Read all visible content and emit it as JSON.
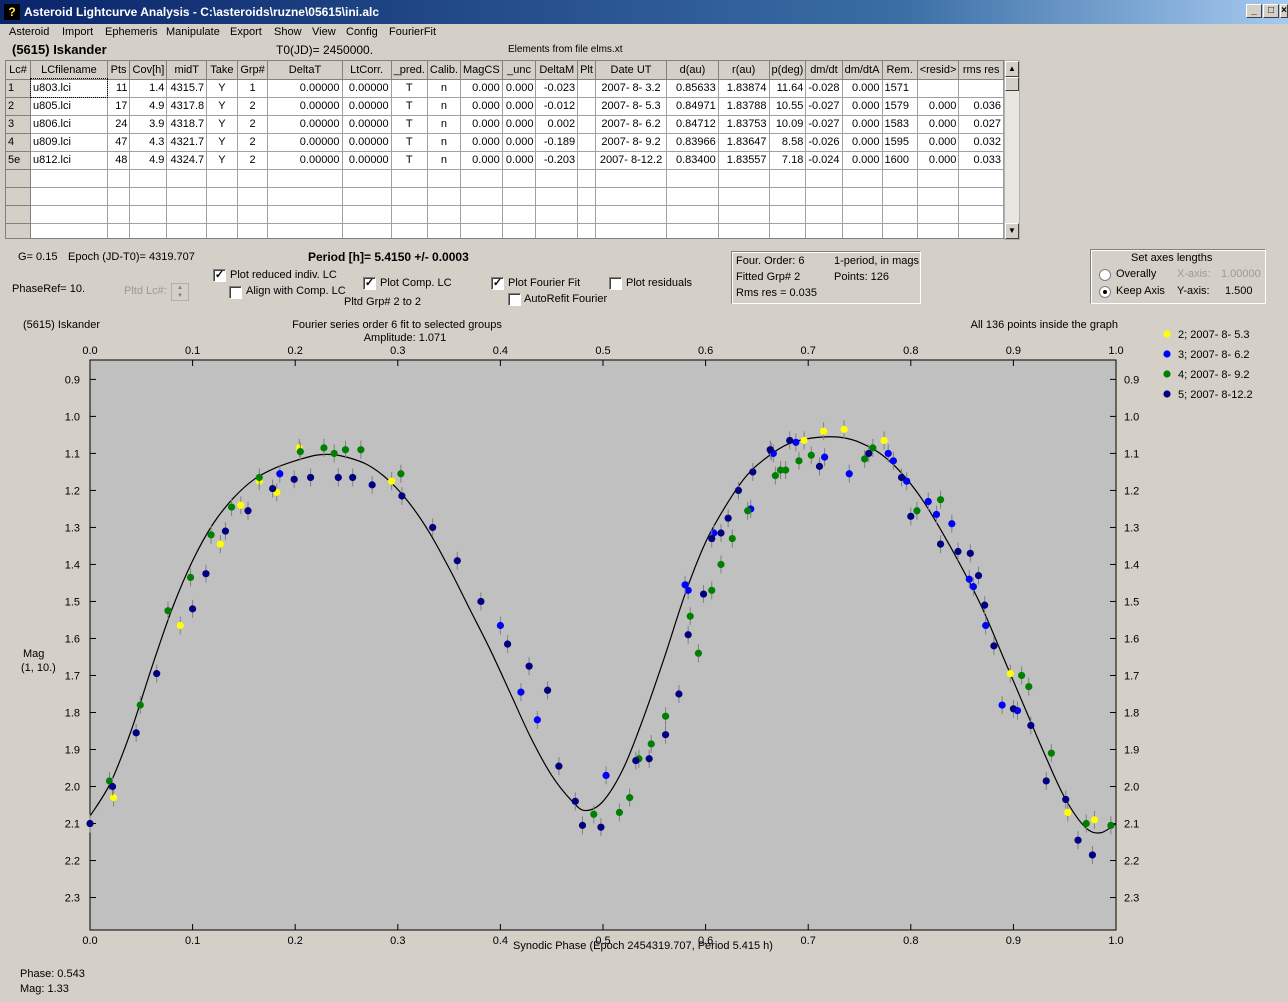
{
  "window": {
    "title": "Asteroid Lightcurve Analysis - C:\\asteroids\\ruzne\\05615\\ini.alc",
    "min": "_",
    "max": "□",
    "close": "×"
  },
  "menu": [
    "Asteroid",
    "Import",
    "Ephemeris",
    "Manipulate",
    "Export",
    "Show",
    "View",
    "Config",
    "FourierFit"
  ],
  "header": {
    "asteroid": "(5615) Iskander",
    "t0": "T0(JD)= 2450000.",
    "elements": "Elements from file elms.xt"
  },
  "table": {
    "columns": [
      "Lc#",
      "LCfilename",
      "Pts",
      "Cov[h]",
      "midT",
      "Take",
      "Grp#",
      "DeltaT",
      "LtCorr.",
      "_pred.",
      "Calib.",
      "MagCS",
      "_unc",
      "DeltaM",
      "Plt",
      "Date UT",
      "d(au)",
      "r(au)",
      "p(deg)",
      "dm/dt",
      "dm/dtA",
      "Rem.",
      "<resid>",
      "rms res"
    ],
    "rows": [
      [
        "1",
        "u803.lci",
        "11",
        "1.4",
        "4315.7",
        "Y",
        "1",
        "0.00000",
        "0.00000",
        "T",
        "n",
        "0.000",
        "0.000",
        "-0.023",
        "",
        "2007- 8- 3.2",
        "0.85633",
        "1.83874",
        "11.64",
        "-0.028",
        "0.000",
        "1571",
        "",
        ""
      ],
      [
        "2",
        "u805.lci",
        "17",
        "4.9",
        "4317.8",
        "Y",
        "2",
        "0.00000",
        "0.00000",
        "T",
        "n",
        "0.000",
        "0.000",
        "-0.012",
        "",
        "2007- 8- 5.3",
        "0.84971",
        "1.83788",
        "10.55",
        "-0.027",
        "0.000",
        "1579",
        "0.000",
        "0.036"
      ],
      [
        "3",
        "u806.lci",
        "24",
        "3.9",
        "4318.7",
        "Y",
        "2",
        "0.00000",
        "0.00000",
        "T",
        "n",
        "0.000",
        "0.000",
        "0.002",
        "",
        "2007- 8- 6.2",
        "0.84712",
        "1.83753",
        "10.09",
        "-0.027",
        "0.000",
        "1583",
        "0.000",
        "0.027"
      ],
      [
        "4",
        "u809.lci",
        "47",
        "4.3",
        "4321.7",
        "Y",
        "2",
        "0.00000",
        "0.00000",
        "T",
        "n",
        "0.000",
        "0.000",
        "-0.189",
        "",
        "2007- 8- 9.2",
        "0.83966",
        "1.83647",
        "8.58",
        "-0.026",
        "0.000",
        "1595",
        "0.000",
        "0.032"
      ],
      [
        "5e",
        "u812.lci",
        "48",
        "4.9",
        "4324.7",
        "Y",
        "2",
        "0.00000",
        "0.00000",
        "T",
        "n",
        "0.000",
        "0.000",
        "-0.203",
        "",
        "2007- 8-12.2",
        "0.83400",
        "1.83557",
        "7.18",
        "-0.024",
        "0.000",
        "1600",
        "0.000",
        "0.033"
      ]
    ],
    "empty_rows": 4
  },
  "info": {
    "g": "G= 0.15",
    "epoch": "Epoch (JD-T0)= 4319.707",
    "period": "Period [h]= 5.4150 +/- 0.0003",
    "phaseref": "PhaseRef= 10.",
    "pltd_lc": "Pltd Lc#:",
    "pltd_grp": "Pltd Grp#  2   to   2"
  },
  "checkboxes": {
    "plot_reduced": {
      "label": "Plot reduced indiv. LC",
      "checked": true
    },
    "align_comp": {
      "label": "Align with Comp. LC",
      "checked": false
    },
    "plot_comp": {
      "label": "Plot Comp. LC",
      "checked": true
    },
    "plot_fourier": {
      "label": "Plot Fourier Fit",
      "checked": true
    },
    "autorefit": {
      "label": "AutoRefit Fourier",
      "checked": false
    },
    "plot_residuals": {
      "label": "Plot residuals",
      "checked": false
    }
  },
  "fourier_box": {
    "order": "Four. Order:  6",
    "fitted": "Fitted Grp# 2",
    "rms": "Rms res     = 0.035",
    "period_note": "1-period, in mags",
    "points": "Points: 126"
  },
  "axes_box": {
    "title": "Set axes lengths",
    "overally": "Overally",
    "keep_axis": "Keep Axis",
    "xaxis_label": "X-axis:",
    "xaxis_value": "1.00000",
    "yaxis_label": "Y-axis:",
    "yaxis_value": "1.500",
    "selected": "keep_axis"
  },
  "status": {
    "phase": "Phase:  0.543",
    "mag": "Mag:    1.33"
  },
  "chart_data": {
    "type": "scatter",
    "title": "(5615) Iskander",
    "subtitle": "Fourier series order 6 fit to selected groups",
    "amplitude": "Amplitude: 1.071",
    "note": "All 136 points inside the graph",
    "xlabel": "Synodic Phase (Epoch 2454319.707, Period 5.415 h)",
    "ylabel": "Mag",
    "ylabel2": "(1, 10.)",
    "xlim": [
      0.0,
      1.0
    ],
    "ylim": [
      2.35,
      0.85
    ],
    "y_inverted": true,
    "xticks": [
      0.0,
      0.1,
      0.2,
      0.3,
      0.4,
      0.5,
      0.6,
      0.7,
      0.8,
      0.9,
      1.0
    ],
    "yticks": [
      0.9,
      1.0,
      1.1,
      1.2,
      1.3,
      1.4,
      1.5,
      1.6,
      1.7,
      1.8,
      1.9,
      2.0,
      2.1,
      2.2,
      2.3
    ],
    "legend_position": "right",
    "series": [
      {
        "name": "2; 2007- 8- 5.3",
        "color": "#ffff00",
        "x": [
          0.023,
          0.088,
          0.127,
          0.147,
          0.165,
          0.182,
          0.204,
          0.294,
          0.696,
          0.715,
          0.735,
          0.774,
          0.897,
          0.953,
          0.979
        ],
        "y": [
          2.03,
          1.565,
          1.345,
          1.24,
          1.175,
          1.205,
          1.085,
          1.175,
          1.065,
          1.04,
          1.035,
          1.065,
          1.695,
          2.07,
          2.09
        ]
      },
      {
        "name": "3; 2007- 8- 6.2",
        "color": "#0000ff",
        "x": [
          0.185,
          0.4,
          0.42,
          0.436,
          0.503,
          0.583,
          0.58,
          0.608,
          0.644,
          0.664,
          0.666,
          0.688,
          0.716,
          0.74,
          0.778,
          0.783,
          0.796,
          0.817,
          0.825,
          0.84,
          0.857,
          0.861,
          0.873,
          0.889,
          0.904
        ],
        "y": [
          1.155,
          1.565,
          1.745,
          1.82,
          1.97,
          1.47,
          1.455,
          1.315,
          1.25,
          1.095,
          1.1,
          1.07,
          1.11,
          1.155,
          1.1,
          1.12,
          1.175,
          1.23,
          1.265,
          1.29,
          1.44,
          1.46,
          1.565,
          1.78,
          1.795
        ]
      },
      {
        "name": "4; 2007- 8- 9.2",
        "color": "#008000",
        "x": [
          0.019,
          0.049,
          0.076,
          0.098,
          0.118,
          0.138,
          0.165,
          0.205,
          0.228,
          0.238,
          0.249,
          0.264,
          0.303,
          0.491,
          0.516,
          0.526,
          0.535,
          0.547,
          0.561,
          0.585,
          0.593,
          0.606,
          0.615,
          0.626,
          0.641,
          0.668,
          0.673,
          0.678,
          0.691,
          0.703,
          0.755,
          0.763,
          0.806,
          0.829,
          0.908,
          0.915,
          0.937,
          0.971,
          0.995
        ],
        "y": [
          1.985,
          1.78,
          1.525,
          1.435,
          1.32,
          1.245,
          1.165,
          1.095,
          1.085,
          1.1,
          1.09,
          1.09,
          1.155,
          2.075,
          2.07,
          2.03,
          1.925,
          1.885,
          1.81,
          1.54,
          1.64,
          1.47,
          1.4,
          1.33,
          1.255,
          1.16,
          1.145,
          1.145,
          1.12,
          1.105,
          1.115,
          1.085,
          1.255,
          1.225,
          1.7,
          1.73,
          1.91,
          2.1,
          2.105
        ]
      },
      {
        "name": "5; 2007- 8-12.2",
        "color": "#000080",
        "x": [
          0.0,
          0.022,
          0.045,
          0.065,
          0.1,
          0.113,
          0.132,
          0.154,
          0.178,
          0.199,
          0.215,
          0.242,
          0.256,
          0.275,
          0.304,
          0.334,
          0.358,
          0.381,
          0.407,
          0.428,
          0.446,
          0.457,
          0.473,
          0.48,
          0.498,
          0.532,
          0.545,
          0.561,
          0.574,
          0.583,
          0.598,
          0.606,
          0.615,
          0.622,
          0.632,
          0.646,
          0.663,
          0.682,
          0.711,
          0.759,
          0.791,
          0.8,
          0.829,
          0.846,
          0.858,
          0.866,
          0.872,
          0.881,
          0.9,
          0.917,
          0.932,
          0.951,
          0.963,
          0.977
        ],
        "y": [
          2.1,
          2.0,
          1.855,
          1.695,
          1.52,
          1.425,
          1.31,
          1.255,
          1.195,
          1.17,
          1.165,
          1.165,
          1.165,
          1.185,
          1.215,
          1.3,
          1.39,
          1.5,
          1.615,
          1.675,
          1.74,
          1.945,
          2.04,
          2.105,
          2.11,
          1.93,
          1.925,
          1.86,
          1.75,
          1.59,
          1.48,
          1.33,
          1.315,
          1.275,
          1.2,
          1.15,
          1.09,
          1.065,
          1.135,
          1.1,
          1.165,
          1.27,
          1.345,
          1.365,
          1.37,
          1.43,
          1.51,
          1.62,
          1.79,
          1.835,
          1.985,
          2.035,
          2.145,
          2.185
        ]
      }
    ],
    "fit_curve": {
      "color": "#000000",
      "x": [
        0.0,
        0.02,
        0.04,
        0.06,
        0.08,
        0.1,
        0.12,
        0.14,
        0.16,
        0.18,
        0.2,
        0.22,
        0.235,
        0.25,
        0.27,
        0.29,
        0.31,
        0.33,
        0.35,
        0.37,
        0.39,
        0.41,
        0.43,
        0.45,
        0.47,
        0.483,
        0.5,
        0.52,
        0.54,
        0.56,
        0.58,
        0.6,
        0.62,
        0.64,
        0.66,
        0.68,
        0.7,
        0.72,
        0.735,
        0.75,
        0.77,
        0.79,
        0.81,
        0.83,
        0.85,
        0.87,
        0.89,
        0.91,
        0.93,
        0.95,
        0.97,
        0.985,
        1.0
      ],
      "y": [
        2.08,
        1.99,
        1.85,
        1.68,
        1.52,
        1.39,
        1.29,
        1.22,
        1.17,
        1.14,
        1.12,
        1.105,
        1.103,
        1.11,
        1.13,
        1.17,
        1.23,
        1.31,
        1.41,
        1.52,
        1.63,
        1.75,
        1.87,
        1.97,
        2.04,
        2.065,
        2.04,
        1.95,
        1.81,
        1.65,
        1.48,
        1.34,
        1.24,
        1.16,
        1.11,
        1.075,
        1.06,
        1.055,
        1.058,
        1.07,
        1.1,
        1.15,
        1.22,
        1.31,
        1.41,
        1.52,
        1.65,
        1.78,
        1.91,
        2.03,
        2.11,
        2.125,
        2.1
      ]
    }
  }
}
